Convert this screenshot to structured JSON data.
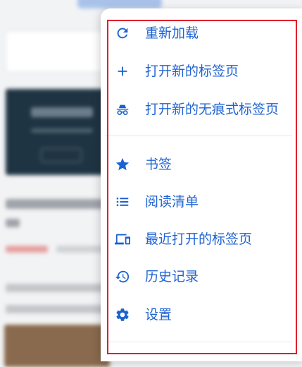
{
  "menu": {
    "accent_color": "#1a62d0",
    "items": [
      {
        "label": "重新加载",
        "icon": "reload-icon"
      },
      {
        "label": "打开新的标签页",
        "icon": "plus-icon"
      },
      {
        "label": "打开新的无痕式标签页",
        "icon": "incognito-icon"
      },
      {
        "label": "书签",
        "icon": "star-icon"
      },
      {
        "label": "阅读清单",
        "icon": "list-icon"
      },
      {
        "label": "最近打开的标签页",
        "icon": "devices-icon"
      },
      {
        "label": "历史记录",
        "icon": "history-icon"
      },
      {
        "label": "设置",
        "icon": "gear-icon"
      }
    ]
  }
}
